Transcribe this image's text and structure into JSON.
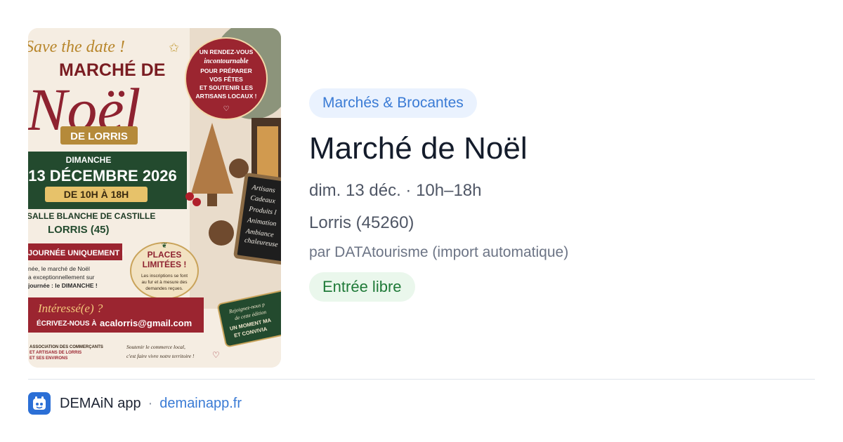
{
  "poster": {
    "save_the_date": "Save the date !",
    "marche_de": "MARCHÉ DE",
    "noel": "Noël",
    "de_lorris": "DE LORRIS",
    "bubble_lines": [
      "UN RENDEZ-VOUS",
      "incontournable",
      "POUR PRÉPARER",
      "VOS FÊTES",
      "ET SOUTENIR LES",
      "ARTISANS LOCAUX !"
    ],
    "dimanche": "DIMANCHE",
    "date_line": "13 DÉCEMBRE 2026",
    "hours": "DE 10H À 18H",
    "venue": "SALLE BLANCHE DE CASTILLE",
    "town": "LORRIS (45)",
    "journee": "JOURNÉE UNIQUEMENT !",
    "note_lines": [
      "née, le marché de Noël",
      "a exceptionnellement sur",
      "journée : le DIMANCHE !"
    ],
    "places_title_1": "PLACES",
    "places_title_2": "LIMITÉES !",
    "places_lines": [
      "Les inscriptions se font",
      "au fur et à mesure des",
      "demandes reçues."
    ],
    "board_lines": [
      "Artisans",
      "Cadeaux",
      "Produits l",
      "Animation",
      "Ambiance",
      "chaleureuse"
    ],
    "interesse": "Intéressé(e) ?",
    "ecrivez": "ÉCRIVEZ-NOUS À",
    "email": "acalorris@gmail.com",
    "tag_lines": [
      "Rejoignez-nous p",
      "de cette édition",
      "UN MOMENT MA",
      "ET CONVIVIA"
    ],
    "assoc_lines": [
      "ASSOCIATION DES COMMERÇANTS",
      "ET ARTISANS DE LORRIS",
      "ET SES ENVIRONS"
    ],
    "slogan_lines": [
      "Soutenir le commerce local,",
      "c'est faire vivre notre territoire !"
    ]
  },
  "event": {
    "category": "Marchés & Brocantes",
    "title": "Marché de Noël",
    "datetime": "dim. 13 déc. · 10h–18h",
    "location": "Lorris (45260)",
    "organizer": "par DATAtourisme (import automatique)",
    "price": "Entrée libre"
  },
  "footer": {
    "app_name": "DEMAiN app",
    "separator": "·",
    "url": "demainapp.fr",
    "logo_icon": "demain-logo-icon"
  },
  "colors": {
    "accent_blue": "#3a7bd5",
    "poster_red": "#9b2530",
    "poster_green": "#234a2e",
    "poster_gold": "#c08a2c",
    "price_green": "#1f7a38"
  }
}
